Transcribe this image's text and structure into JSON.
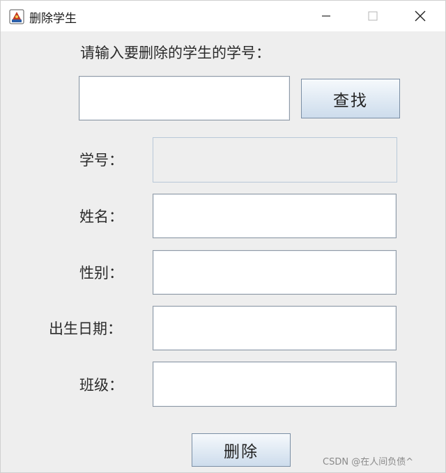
{
  "window": {
    "title": "删除学生",
    "controls": {
      "minimize": "minimize-icon",
      "maximize": "maximize-icon",
      "close": "close-icon"
    }
  },
  "form": {
    "prompt_label": "请输入要删除的学生的学号：",
    "search_value": "",
    "search_button": "查找",
    "fields": [
      {
        "label": "学号：",
        "value": "",
        "disabled": true
      },
      {
        "label": "姓名：",
        "value": ""
      },
      {
        "label": "性别：",
        "value": ""
      },
      {
        "label": "出生日期：",
        "value": ""
      },
      {
        "label": "班级：",
        "value": ""
      }
    ],
    "delete_button": "删除"
  },
  "watermark": "CSDN @在人间负债^",
  "colors": {
    "window_bg": "#eeeeee",
    "titlebar_bg": "#ffffff",
    "button_gradient_top": "#f6f9fc",
    "button_gradient_bottom": "#cddcec",
    "field_border": "#8f9aa6",
    "disabled_border": "#b8c8d8"
  }
}
